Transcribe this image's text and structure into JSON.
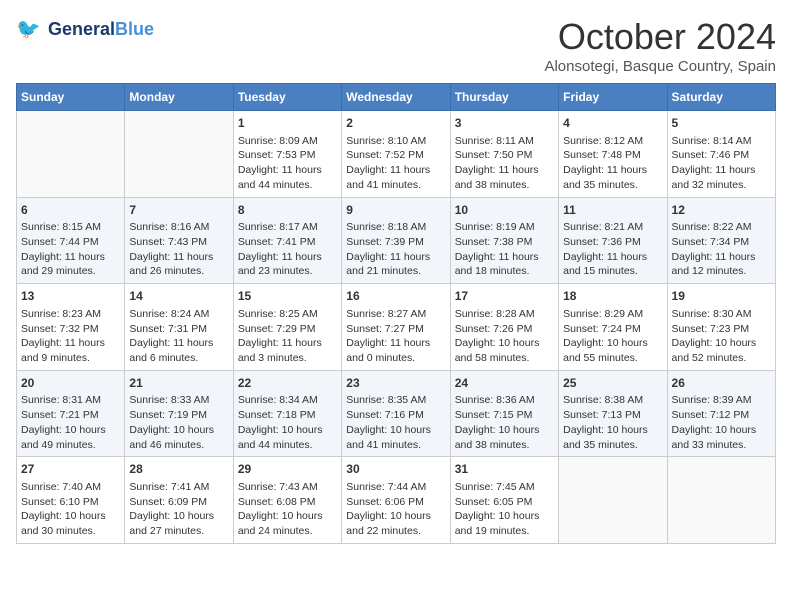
{
  "logo": {
    "line1": "General",
    "line2": "Blue"
  },
  "title": "October 2024",
  "location": "Alonsotegi, Basque Country, Spain",
  "headers": [
    "Sunday",
    "Monday",
    "Tuesday",
    "Wednesday",
    "Thursday",
    "Friday",
    "Saturday"
  ],
  "weeks": [
    [
      {
        "day": "",
        "sunrise": "",
        "sunset": "",
        "daylight": ""
      },
      {
        "day": "",
        "sunrise": "",
        "sunset": "",
        "daylight": ""
      },
      {
        "day": "1",
        "sunrise": "Sunrise: 8:09 AM",
        "sunset": "Sunset: 7:53 PM",
        "daylight": "Daylight: 11 hours and 44 minutes."
      },
      {
        "day": "2",
        "sunrise": "Sunrise: 8:10 AM",
        "sunset": "Sunset: 7:52 PM",
        "daylight": "Daylight: 11 hours and 41 minutes."
      },
      {
        "day": "3",
        "sunrise": "Sunrise: 8:11 AM",
        "sunset": "Sunset: 7:50 PM",
        "daylight": "Daylight: 11 hours and 38 minutes."
      },
      {
        "day": "4",
        "sunrise": "Sunrise: 8:12 AM",
        "sunset": "Sunset: 7:48 PM",
        "daylight": "Daylight: 11 hours and 35 minutes."
      },
      {
        "day": "5",
        "sunrise": "Sunrise: 8:14 AM",
        "sunset": "Sunset: 7:46 PM",
        "daylight": "Daylight: 11 hours and 32 minutes."
      }
    ],
    [
      {
        "day": "6",
        "sunrise": "Sunrise: 8:15 AM",
        "sunset": "Sunset: 7:44 PM",
        "daylight": "Daylight: 11 hours and 29 minutes."
      },
      {
        "day": "7",
        "sunrise": "Sunrise: 8:16 AM",
        "sunset": "Sunset: 7:43 PM",
        "daylight": "Daylight: 11 hours and 26 minutes."
      },
      {
        "day": "8",
        "sunrise": "Sunrise: 8:17 AM",
        "sunset": "Sunset: 7:41 PM",
        "daylight": "Daylight: 11 hours and 23 minutes."
      },
      {
        "day": "9",
        "sunrise": "Sunrise: 8:18 AM",
        "sunset": "Sunset: 7:39 PM",
        "daylight": "Daylight: 11 hours and 21 minutes."
      },
      {
        "day": "10",
        "sunrise": "Sunrise: 8:19 AM",
        "sunset": "Sunset: 7:38 PM",
        "daylight": "Daylight: 11 hours and 18 minutes."
      },
      {
        "day": "11",
        "sunrise": "Sunrise: 8:21 AM",
        "sunset": "Sunset: 7:36 PM",
        "daylight": "Daylight: 11 hours and 15 minutes."
      },
      {
        "day": "12",
        "sunrise": "Sunrise: 8:22 AM",
        "sunset": "Sunset: 7:34 PM",
        "daylight": "Daylight: 11 hours and 12 minutes."
      }
    ],
    [
      {
        "day": "13",
        "sunrise": "Sunrise: 8:23 AM",
        "sunset": "Sunset: 7:32 PM",
        "daylight": "Daylight: 11 hours and 9 minutes."
      },
      {
        "day": "14",
        "sunrise": "Sunrise: 8:24 AM",
        "sunset": "Sunset: 7:31 PM",
        "daylight": "Daylight: 11 hours and 6 minutes."
      },
      {
        "day": "15",
        "sunrise": "Sunrise: 8:25 AM",
        "sunset": "Sunset: 7:29 PM",
        "daylight": "Daylight: 11 hours and 3 minutes."
      },
      {
        "day": "16",
        "sunrise": "Sunrise: 8:27 AM",
        "sunset": "Sunset: 7:27 PM",
        "daylight": "Daylight: 11 hours and 0 minutes."
      },
      {
        "day": "17",
        "sunrise": "Sunrise: 8:28 AM",
        "sunset": "Sunset: 7:26 PM",
        "daylight": "Daylight: 10 hours and 58 minutes."
      },
      {
        "day": "18",
        "sunrise": "Sunrise: 8:29 AM",
        "sunset": "Sunset: 7:24 PM",
        "daylight": "Daylight: 10 hours and 55 minutes."
      },
      {
        "day": "19",
        "sunrise": "Sunrise: 8:30 AM",
        "sunset": "Sunset: 7:23 PM",
        "daylight": "Daylight: 10 hours and 52 minutes."
      }
    ],
    [
      {
        "day": "20",
        "sunrise": "Sunrise: 8:31 AM",
        "sunset": "Sunset: 7:21 PM",
        "daylight": "Daylight: 10 hours and 49 minutes."
      },
      {
        "day": "21",
        "sunrise": "Sunrise: 8:33 AM",
        "sunset": "Sunset: 7:19 PM",
        "daylight": "Daylight: 10 hours and 46 minutes."
      },
      {
        "day": "22",
        "sunrise": "Sunrise: 8:34 AM",
        "sunset": "Sunset: 7:18 PM",
        "daylight": "Daylight: 10 hours and 44 minutes."
      },
      {
        "day": "23",
        "sunrise": "Sunrise: 8:35 AM",
        "sunset": "Sunset: 7:16 PM",
        "daylight": "Daylight: 10 hours and 41 minutes."
      },
      {
        "day": "24",
        "sunrise": "Sunrise: 8:36 AM",
        "sunset": "Sunset: 7:15 PM",
        "daylight": "Daylight: 10 hours and 38 minutes."
      },
      {
        "day": "25",
        "sunrise": "Sunrise: 8:38 AM",
        "sunset": "Sunset: 7:13 PM",
        "daylight": "Daylight: 10 hours and 35 minutes."
      },
      {
        "day": "26",
        "sunrise": "Sunrise: 8:39 AM",
        "sunset": "Sunset: 7:12 PM",
        "daylight": "Daylight: 10 hours and 33 minutes."
      }
    ],
    [
      {
        "day": "27",
        "sunrise": "Sunrise: 7:40 AM",
        "sunset": "Sunset: 6:10 PM",
        "daylight": "Daylight: 10 hours and 30 minutes."
      },
      {
        "day": "28",
        "sunrise": "Sunrise: 7:41 AM",
        "sunset": "Sunset: 6:09 PM",
        "daylight": "Daylight: 10 hours and 27 minutes."
      },
      {
        "day": "29",
        "sunrise": "Sunrise: 7:43 AM",
        "sunset": "Sunset: 6:08 PM",
        "daylight": "Daylight: 10 hours and 24 minutes."
      },
      {
        "day": "30",
        "sunrise": "Sunrise: 7:44 AM",
        "sunset": "Sunset: 6:06 PM",
        "daylight": "Daylight: 10 hours and 22 minutes."
      },
      {
        "day": "31",
        "sunrise": "Sunrise: 7:45 AM",
        "sunset": "Sunset: 6:05 PM",
        "daylight": "Daylight: 10 hours and 19 minutes."
      },
      {
        "day": "",
        "sunrise": "",
        "sunset": "",
        "daylight": ""
      },
      {
        "day": "",
        "sunrise": "",
        "sunset": "",
        "daylight": ""
      }
    ]
  ]
}
